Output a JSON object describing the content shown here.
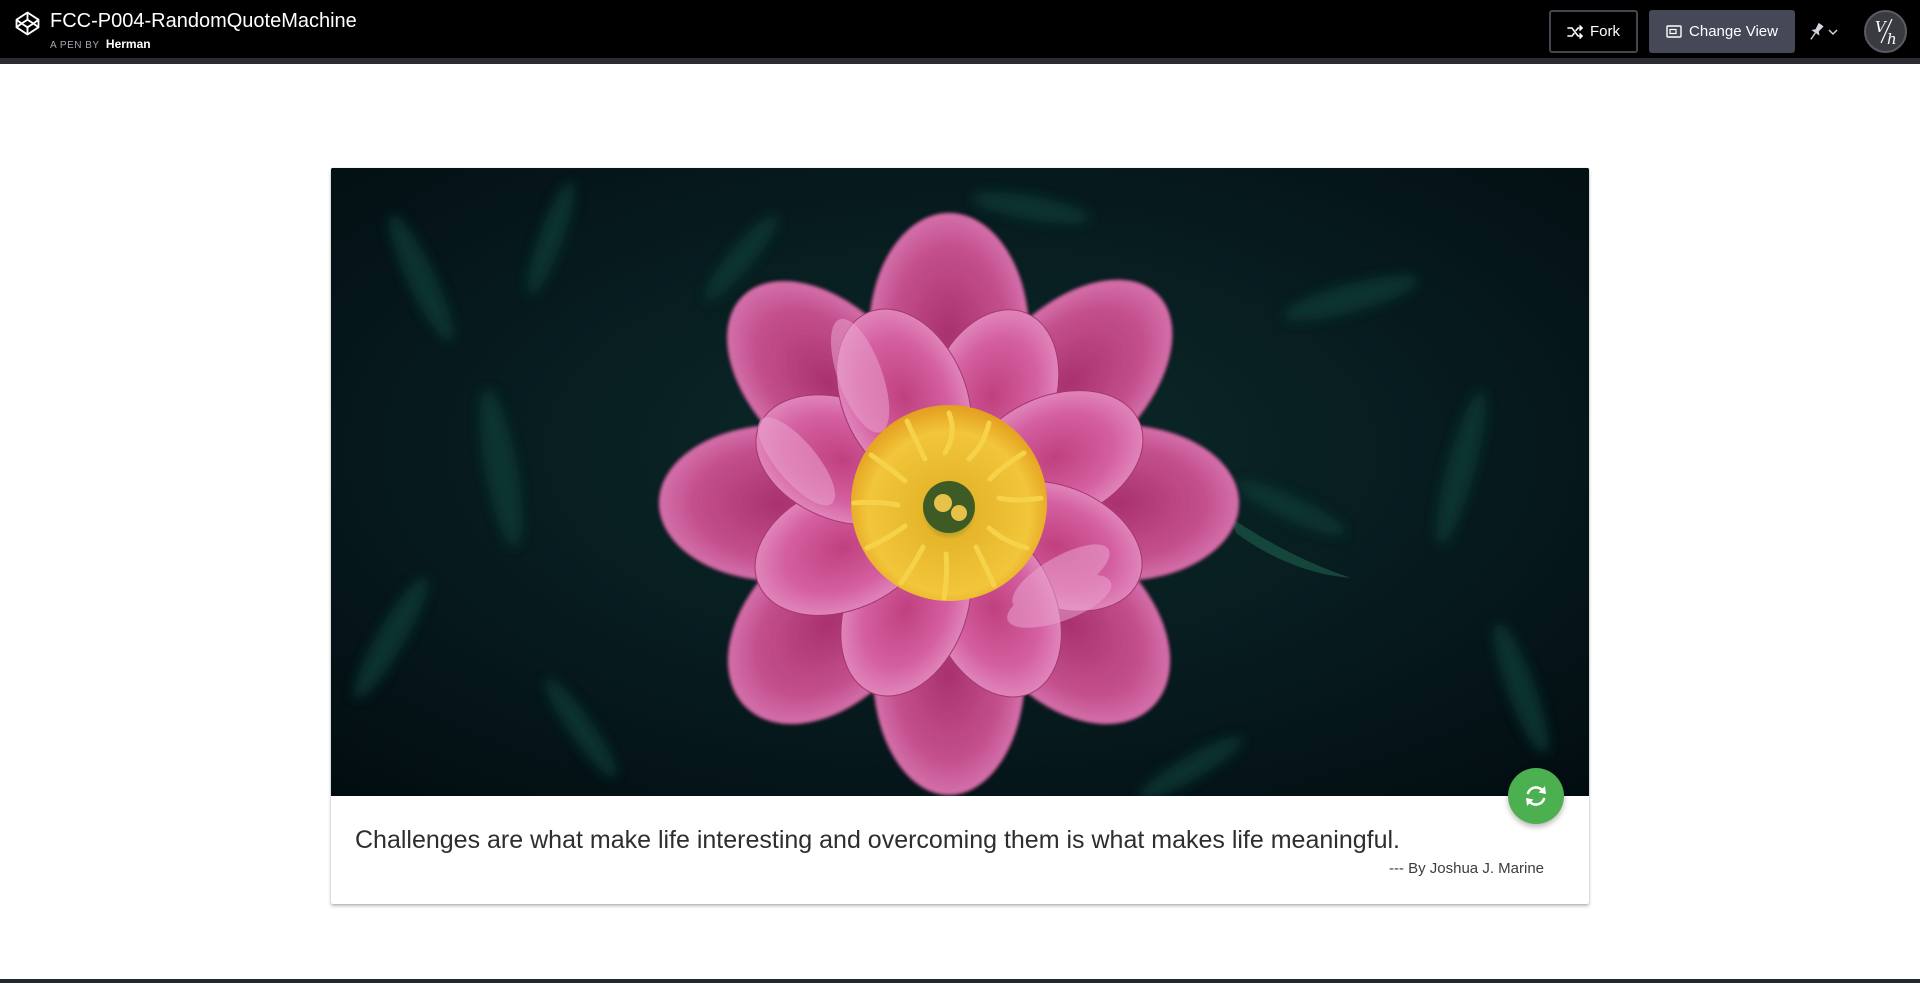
{
  "header": {
    "pen_title": "FCC-P004-RandomQuoteMachine",
    "byline_prefix": "A PEN BY",
    "author": "Herman",
    "fork_label": "Fork",
    "change_view_label": "Change View",
    "avatar_initials": "V/h"
  },
  "icons": {
    "logo": "codepen-logo-icon",
    "fork": "fork-icon",
    "change_view": "window-icon",
    "pin": "pin-icon",
    "pin_dropdown": "chevron-down-icon",
    "refresh": "refresh-icon"
  },
  "card": {
    "image_subject": "pink peony flower",
    "quote": "Challenges are what make life interesting and overcoming them is what makes life meaningful.",
    "author": "--- By Joshua J. Marine"
  },
  "colors": {
    "topbar_bg": "#000000",
    "button_bg": "#444857",
    "refresh_button": "#4caf50",
    "image_bg": "#041518"
  }
}
